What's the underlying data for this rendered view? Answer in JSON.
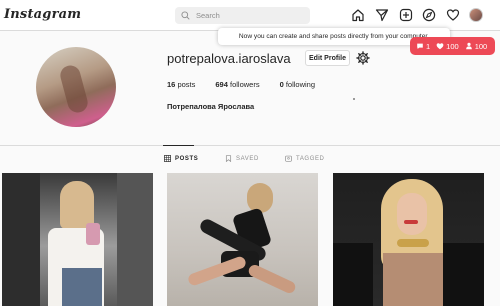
{
  "app": {
    "logo_text": "Instagram"
  },
  "search": {
    "placeholder": "Search"
  },
  "nav": {
    "icons": [
      "home-icon",
      "send-icon",
      "new-post-icon",
      "explore-icon",
      "heart-icon",
      "avatar"
    ]
  },
  "tooltip": {
    "text": "Now you can create and share posts directly from your computer."
  },
  "notifications": {
    "comments": "1",
    "likes": "100",
    "follows": "100",
    "color": "#ed4956"
  },
  "profile": {
    "username": "potrepalova.iaroslava",
    "edit_label": "Edit Profile",
    "posts_count": "16",
    "posts_label": "posts",
    "followers_count": "694",
    "followers_label": "followers",
    "following_count": "0",
    "following_label": "following",
    "full_name": "Потрепалова Ярослава"
  },
  "tabs": [
    {
      "label": "POSTS",
      "icon": "grid-icon",
      "active": true
    },
    {
      "label": "SAVED",
      "icon": "bookmark-icon",
      "active": false
    },
    {
      "label": "TAGGED",
      "icon": "tag-icon",
      "active": false
    }
  ],
  "posts": [
    {
      "alt": "mirror selfie in elevator"
    },
    {
      "alt": "studio pose in black outfit"
    },
    {
      "alt": "portrait in black leather jacket"
    }
  ]
}
